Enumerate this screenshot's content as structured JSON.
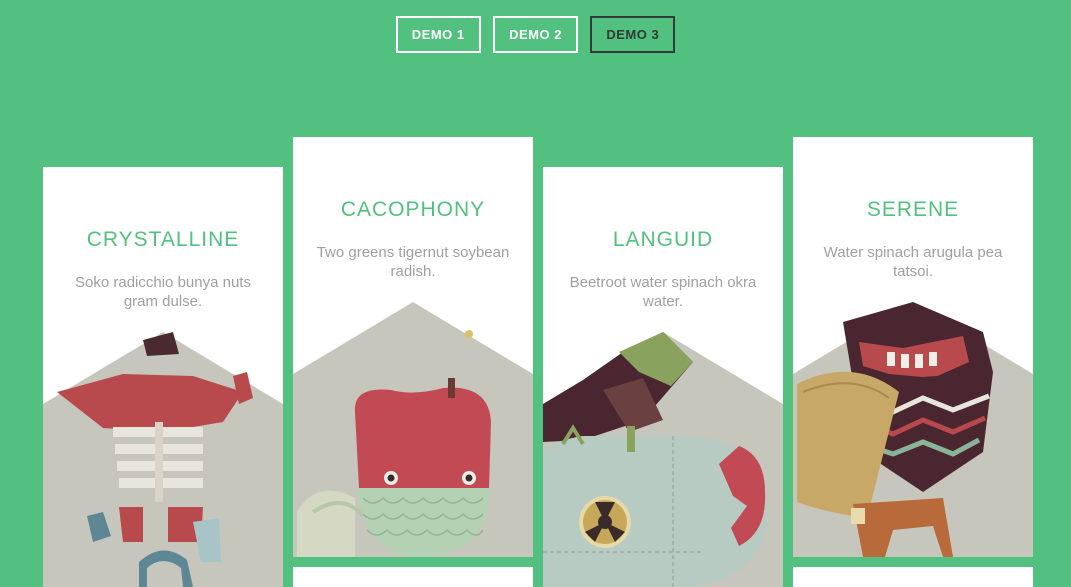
{
  "nav": {
    "buttons": [
      {
        "label": "DEMO 1",
        "active": false
      },
      {
        "label": "DEMO 2",
        "active": false
      },
      {
        "label": "DEMO 3",
        "active": true
      }
    ]
  },
  "cards": [
    {
      "title": "CRYSTALLINE",
      "description": "Soko radicchio bunya nuts gram dulse."
    },
    {
      "title": "CACOPHONY",
      "description": "Two greens tigernut soybean radish."
    },
    {
      "title": "LANGUID",
      "description": "Beetroot water spinach okra water."
    },
    {
      "title": "SERENE",
      "description": "Water spinach arugula pea tatsoi."
    }
  ],
  "colors": {
    "background": "#52c07e",
    "accent": "#52c07e",
    "active_nav": "#2f3b36"
  }
}
